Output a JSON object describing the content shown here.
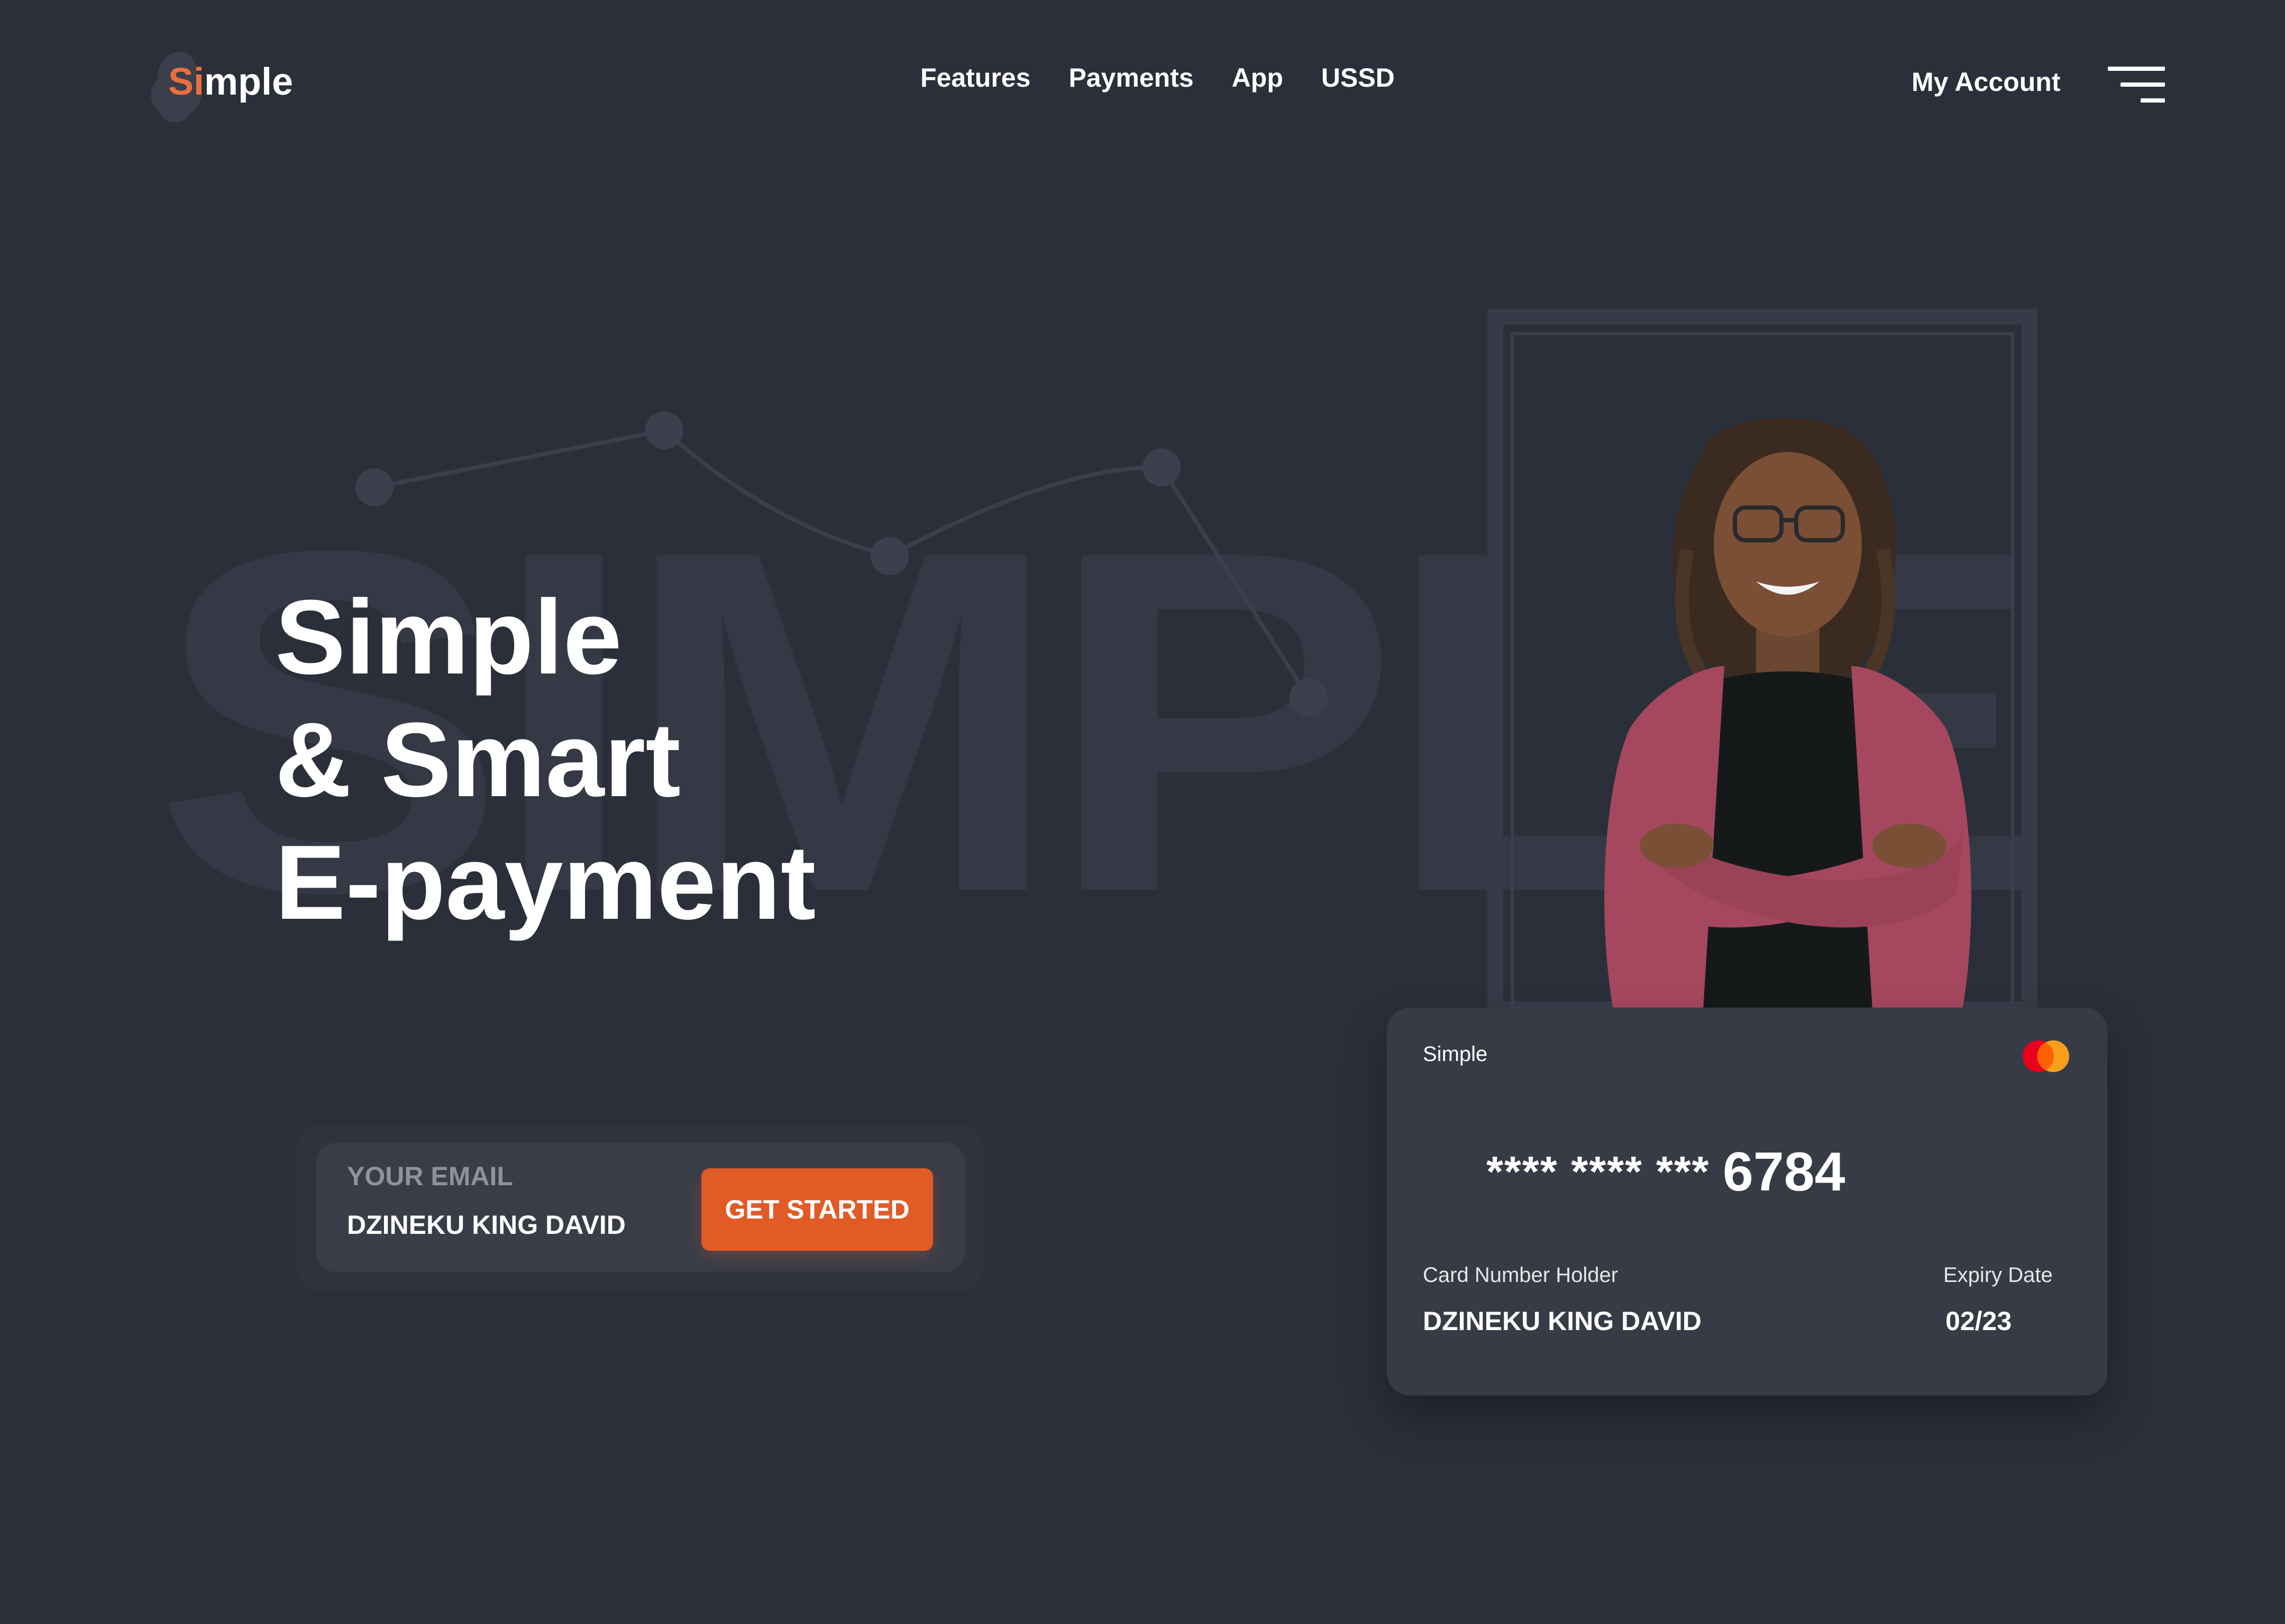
{
  "header": {
    "logo": {
      "accent": "Si",
      "rest": "mple"
    },
    "nav": [
      "Features",
      "Payments",
      "App",
      "USSD"
    ],
    "account_label": "My Account",
    "menu_icon": "hamburger-menu-icon"
  },
  "background": {
    "watermark_text": "SIMPLE"
  },
  "hero": {
    "title_line1": "Simple",
    "title_line2": "& Smart",
    "title_line3": "E-payment"
  },
  "signup": {
    "email_label": "YOUR EMAIL",
    "email_value": "DZINEKU KING DAVID",
    "cta_label": "GET STARTED"
  },
  "card": {
    "brand": "Simple",
    "network_icon": "mastercard-icon",
    "number_masked": "**** **** ***",
    "number_last4": "6784",
    "holder_label": "Card Number Holder",
    "holder_name": "DZINEKU KING DAVID",
    "expiry_label": "Expiry Date",
    "expiry_value": "02/23"
  },
  "colors": {
    "background": "#2b2f39",
    "accent": "#e15b26",
    "logo_accent": "#e8703e",
    "card": "#373b46"
  }
}
